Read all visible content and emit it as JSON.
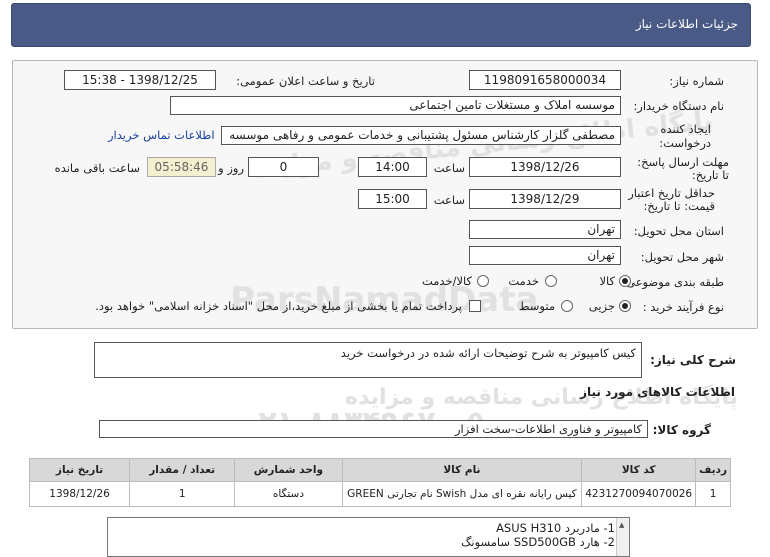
{
  "page_title": "جزئیات اطلاعات نیاز",
  "fields": {
    "need_number_label": "شماره نیاز:",
    "need_number": "1198091658000034",
    "announce_label": "تاریخ و ساعت اعلان عمومی:",
    "announce_value": "1398/12/25 - 15:38",
    "buyer_org_label": "نام دستگاه خریدار:",
    "buyer_org": "موسسه املاک و مستغلات تامین اجتماعی",
    "requester_label_1": "ایجاد کننده",
    "requester_label_2": "درخواست:",
    "requester": "مصطفی گلزار کارشناس مسئول پشتیبانی و خدمات عمومی و رفاهی موسسه",
    "contact_link": "اطلاعات تماس خریدار",
    "reply_label_1": "مهلت ارسال پاسخ:",
    "reply_label_2": "تا تاریخ:",
    "reply_date": "1398/12/26",
    "time_label": "ساعت",
    "reply_time": "14:00",
    "days_label": "روز و",
    "days_value": "0",
    "remaining_time": "05:58:46",
    "remaining_label": "ساعت باقی مانده",
    "validity_label_1": "حداقل تاریخ اعتبار",
    "validity_label_2": "قیمت: تا تاریخ:",
    "validity_date": "1398/12/29",
    "validity_time": "15:00",
    "province_label": "استان محل تحویل:",
    "province": "تهران",
    "city_label": "شهر محل تحویل:",
    "city": "تهران",
    "category_label": "طبقه بندی موضوعی:",
    "category_options": [
      "کالا",
      "خدمت",
      "کالا/خدمت"
    ],
    "process_label": "نوع فرآیند خرید :",
    "process_options": [
      "جزیی",
      "متوسط"
    ],
    "payment_note": "پرداخت تمام یا بخشی از مبلغ خرید،از محل \"اسناد خزانه اسلامی\" خواهد بود."
  },
  "description_label": "شرح کلی نیاز:",
  "description": "کیس کامپیوتر به شرح توضیحات ارائه شده در درخواست خرید",
  "goods_info_title": "اطلاعات کالاهای مورد نیاز",
  "goods_group_label": "گروه کالا:",
  "goods_group": "کامپیوتر و فناوری اطلاعات-سخت افزار",
  "table": {
    "headers": [
      "ردیف",
      "کد کالا",
      "نام کالا",
      "واحد شمارش",
      "تعداد / مقدار",
      "تاریخ نیاز"
    ],
    "rows": [
      [
        "1",
        "4231270094070026",
        "کیس رایانه نقره ای مدل Swish نام تجارتی GREEN",
        "دستگاه",
        "1",
        "1398/12/26"
      ]
    ]
  },
  "notes": [
    "1- مادربرد ASUS H310",
    "2- هارد SSD500GB سامسونگ"
  ],
  "watermark": {
    "line1": "پایگاه اطلاع رسانی مناقصه و مزایده",
    "line2": "۰۲۱-۸۸۳۴۹۶۷۰-۵",
    "line3": "ParsNamadData"
  },
  "colors": {
    "header_bg": "#495a86",
    "timer_bg": "#f4efcf",
    "link": "#1a3f9e"
  }
}
